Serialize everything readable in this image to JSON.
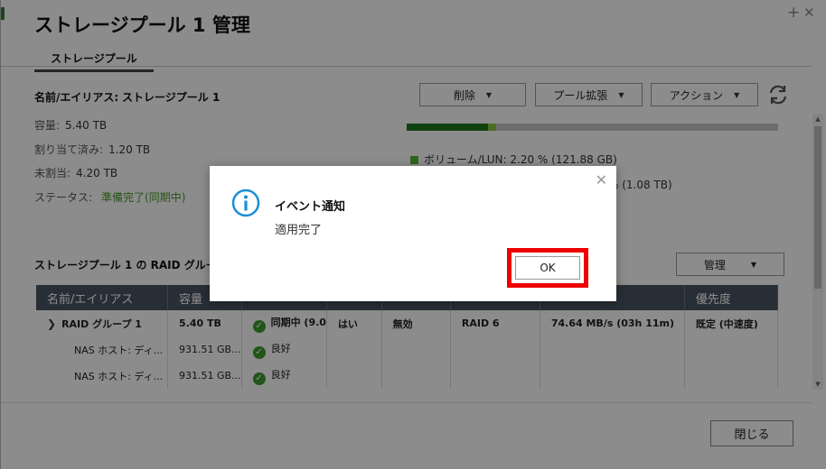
{
  "window": {
    "title": "ストレージプール 1 管理",
    "add_glyph": "+",
    "close_glyph": "✕"
  },
  "tabs": [
    {
      "label": "ストレージプール"
    }
  ],
  "pool": {
    "name_label": "名前/エイリアス:",
    "name_value": "ストレージプール 1",
    "capacity_label": "容量:",
    "capacity_value": "5.40 TB",
    "allocated_label": "割り当て済み:",
    "allocated_value": "1.20 TB",
    "unallocated_label": "未割当:",
    "unallocated_value": "4.20 TB",
    "status_label": "ステータス:",
    "status_value": "準備完了(同期中)"
  },
  "actions": {
    "delete_label": "削除",
    "expand_label": "プール拡張",
    "action_label": "アクション",
    "caret": "▼"
  },
  "usage": {
    "volume_fraction": 0.22,
    "snapshot_fraction": 0.02,
    "volume_legend": "ボリューム/LUN: 2.20 % (121.88 GB)",
    "second_legend_value": "% (1.08 TB)",
    "volume_color": "#1f7a1f",
    "light_color": "#8cc63f"
  },
  "raid_section": {
    "title": "ストレージプール 1 の RAID グループ",
    "manage_label": "管理"
  },
  "table": {
    "headers": [
      "名前/エイリアス",
      "容量",
      "",
      "",
      "",
      "",
      "",
      "優先度"
    ],
    "rows": [
      {
        "name": "RAID グループ 1",
        "capacity": "5.40 TB",
        "status": "同期中 (9.0",
        "c3": "はい",
        "c4": "無効",
        "c5": "RAID 6",
        "c6": "74.64 MB/s (03h 11m)",
        "priority": "既定 (中速度)"
      },
      {
        "name": "NAS ホスト: ディ...",
        "capacity": "931.51 GB...",
        "status": "良好",
        "c3": "",
        "c4": "",
        "c5": "",
        "c6": "",
        "priority": ""
      },
      {
        "name": "NAS ホスト: ディ...",
        "capacity": "931.51 GB...",
        "status": "良好",
        "c3": "",
        "c4": "",
        "c5": "",
        "c6": "",
        "priority": ""
      }
    ]
  },
  "footer": {
    "close_label": "閉じる"
  },
  "dialog": {
    "title": "イベント通知",
    "message": "適用完了",
    "ok_label": "OK",
    "close_glyph": "✕",
    "icon": "info-icon",
    "accent": "#1a8fd8"
  }
}
